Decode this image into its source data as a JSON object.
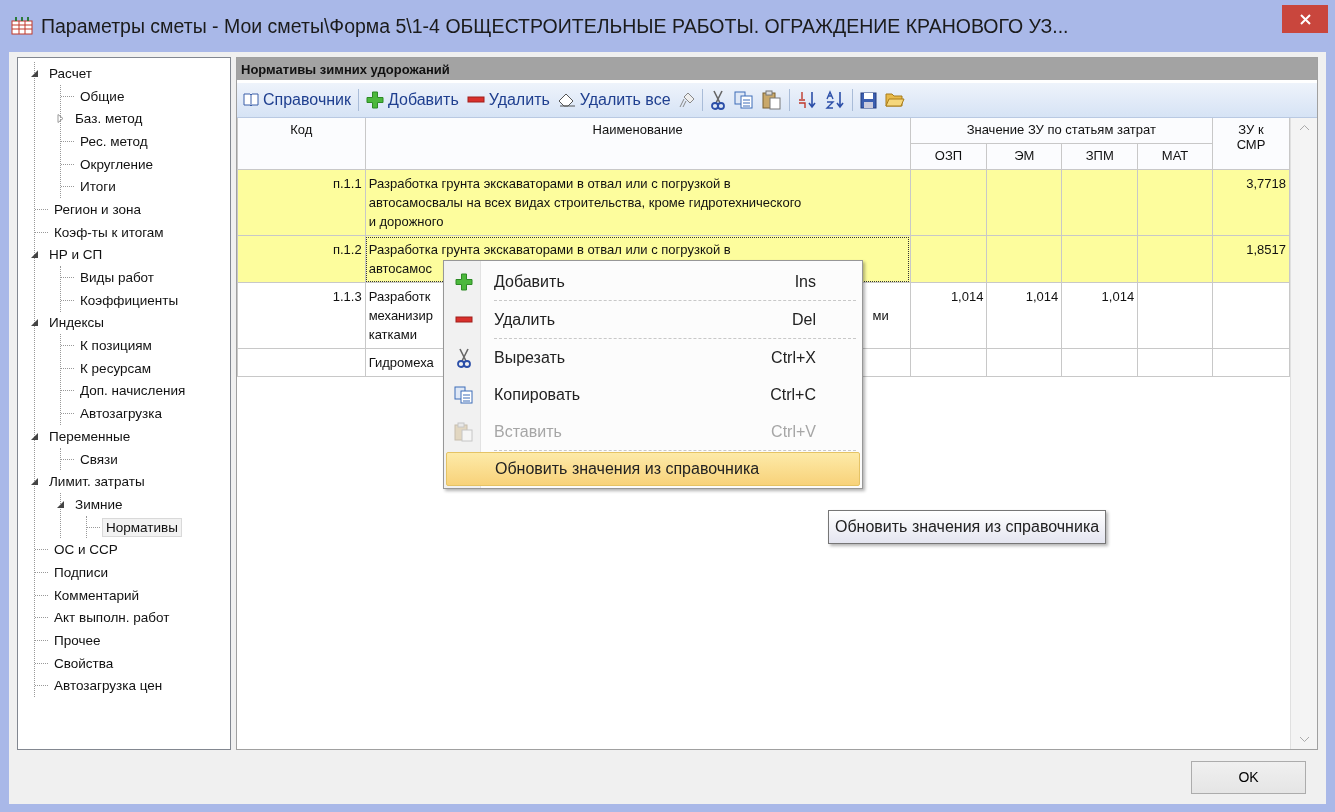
{
  "window": {
    "title": "Параметры сметы - Мои сметы\\Форма 5\\1-4 ОБЩЕСТРОИТЕЛЬНЫЕ РАБОТЫ. ОГРАЖДЕНИЕ КРАНОВОГО УЗ..."
  },
  "tree": {
    "items": [
      {
        "label": "Расчет",
        "selected": false,
        "expanded": true,
        "children": [
          {
            "label": "Общие",
            "selected": false
          },
          {
            "label": "Баз. метод",
            "selected": false,
            "expanded": false
          },
          {
            "label": "Рес. метод",
            "selected": false
          },
          {
            "label": "Округление",
            "selected": false
          },
          {
            "label": "Итоги",
            "selected": false
          }
        ]
      },
      {
        "label": "Регион и зона",
        "selected": false
      },
      {
        "label": "Коэф-ты к итогам",
        "selected": false
      },
      {
        "label": "НР и СП",
        "selected": false,
        "expanded": true,
        "children": [
          {
            "label": "Виды работ",
            "selected": false
          },
          {
            "label": "Коэффициенты",
            "selected": false
          }
        ]
      },
      {
        "label": "Индексы",
        "selected": false,
        "expanded": true,
        "children": [
          {
            "label": "К позициям",
            "selected": false
          },
          {
            "label": "К ресурсам",
            "selected": false
          },
          {
            "label": "Доп. начисления",
            "selected": false
          },
          {
            "label": "Автозагрузка",
            "selected": false
          }
        ]
      },
      {
        "label": "Переменные",
        "selected": false,
        "expanded": true,
        "children": [
          {
            "label": "Связи",
            "selected": false
          }
        ]
      },
      {
        "label": "Лимит. затраты",
        "selected": false,
        "expanded": true,
        "children": [
          {
            "label": "Зимние",
            "selected": false,
            "expanded": true,
            "children": [
              {
                "label": "Нормативы",
                "selected": true
              }
            ]
          }
        ]
      },
      {
        "label": "ОС и ССР",
        "selected": false
      },
      {
        "label": "Подписи",
        "selected": false
      },
      {
        "label": "Комментарий",
        "selected": false
      },
      {
        "label": "Акт выполн. работ",
        "selected": false
      },
      {
        "label": "Прочее",
        "selected": false
      },
      {
        "label": "Свойства",
        "selected": false
      },
      {
        "label": "Автозагрузка цен",
        "selected": false
      }
    ]
  },
  "panel": {
    "title": "Нормативы зимних удорожаний",
    "toolbar": [
      {
        "label": "Справочник",
        "kind": "book"
      },
      {
        "label": "Добавить",
        "kind": "plus"
      },
      {
        "label": "Удалить",
        "kind": "minus"
      },
      {
        "label": "Удалить все",
        "kind": "eraser"
      }
    ],
    "table": {
      "columns": {
        "code": "Код",
        "name": "Наименование",
        "group": "Значение ЗУ по статьям затрат",
        "ozp": "ОЗП",
        "em": "ЭМ",
        "zpm": "ЗПМ",
        "mat": "МАТ",
        "zu": "ЗУ к СМР"
      },
      "rows": [
        {
          "selected": true,
          "focused": false,
          "code": "п.1.1",
          "name_lines": [
            [
              "Разработка грунта экскаваторами в отвал или с погрузкой в"
            ],
            [
              "автосамосвалы на всех видах строительства, кроме гидротехнического"
            ],
            [
              "и дорожного"
            ]
          ],
          "zu": "3,7718"
        },
        {
          "selected": true,
          "focused": true,
          "code": "п.1.2",
          "name_lines": [
            [
              "Разработка грунта экскаваторами в отвал или с погрузкой в"
            ],
            [
              "автосамос"
            ]
          ],
          "zu": "1,8517"
        },
        {
          "selected": false,
          "focused": false,
          "code": "1.1.3",
          "name_lines": [
            [
              "Разработк"
            ],
            [
              "механизир",
              "ми"
            ],
            [
              "катками"
            ]
          ],
          "ozp": "1,014",
          "em": "1,014",
          "zpm": "1,014"
        },
        {
          "selected": false,
          "focused": false,
          "name_lines": [
            [
              "Гидромеха"
            ]
          ]
        }
      ]
    }
  },
  "context_menu": {
    "items": [
      {
        "label": "Добавить",
        "shortcut": "Ins",
        "kind": "plus",
        "disabled": false,
        "highlighted": false,
        "separator_after": true
      },
      {
        "label": "Удалить",
        "shortcut": "Del",
        "kind": "minus",
        "disabled": false,
        "highlighted": false,
        "separator_after": true
      },
      {
        "label": "Вырезать",
        "shortcut": "Ctrl+X",
        "kind": "cut",
        "disabled": false,
        "highlighted": false,
        "separator_after": false
      },
      {
        "label": "Копировать",
        "shortcut": "Ctrl+C",
        "kind": "copy",
        "disabled": false,
        "highlighted": false,
        "separator_after": false
      },
      {
        "label": "Вставить",
        "shortcut": "Ctrl+V",
        "kind": "paste",
        "disabled": true,
        "highlighted": false,
        "separator_after": true
      },
      {
        "label": "Обновить значения из справочника",
        "kind": "plain",
        "disabled": false,
        "highlighted": true,
        "separator_after": false
      }
    ]
  },
  "tooltip": {
    "text": "Обновить значения из справочника"
  },
  "buttons": [
    {
      "label": "OK"
    }
  ]
}
